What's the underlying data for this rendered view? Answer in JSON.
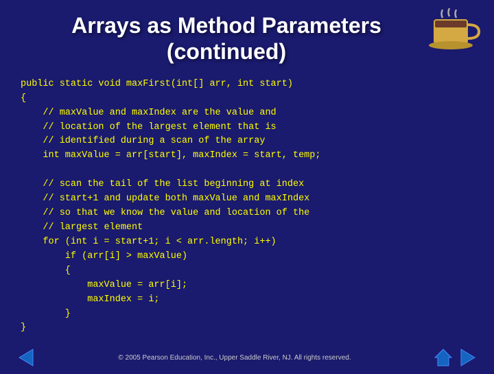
{
  "title": {
    "line1": "Arrays as Method Parameters",
    "line2": "(continued)"
  },
  "code": {
    "lines": [
      "public static void maxFirst(int[] arr, int start)",
      "{",
      "    // maxValue and maxIndex are the value and",
      "    // location of the largest element that is",
      "    // identified during a scan of the array",
      "    int maxValue = arr[start], maxIndex = start, temp;",
      "",
      "    // scan the tail of the list beginning at index",
      "    // start+1 and update both maxValue and maxIndex",
      "    // so that we know the value and location of the",
      "    // largest element",
      "    for (int i = start+1; i < arr.length; i++)",
      "        if (arr[i] > maxValue)",
      "        {",
      "            maxValue = arr[i];",
      "            maxIndex = i;",
      "        }",
      "}"
    ]
  },
  "footer": {
    "copyright": "© 2005 Pearson Education, Inc.,  Upper Saddle River, NJ.  All rights reserved."
  },
  "nav": {
    "back_label": "◀",
    "home_label": "⌂",
    "forward_label": "▶"
  },
  "colors": {
    "background": "#1a1a6e",
    "title": "#ffffff",
    "code": "#ffff00",
    "footer": "#cccccc"
  }
}
